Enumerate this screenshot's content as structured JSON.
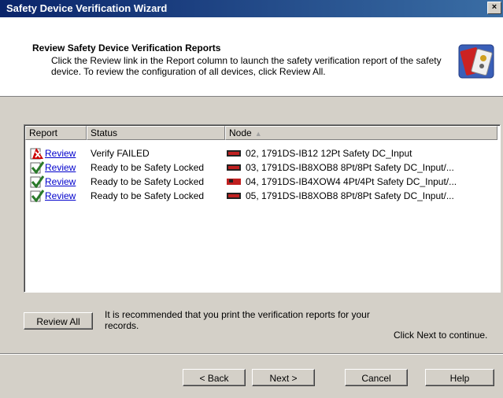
{
  "window": {
    "title": "Safety Device Verification Wizard",
    "close_label": "×"
  },
  "header": {
    "title": "Review Safety Device Verification Reports",
    "description": "Click the Review link in the Report column to launch the safety verification report of the safety device. To review the configuration of all devices, click Review All."
  },
  "table": {
    "columns": [
      "Report",
      "Status",
      "Node"
    ],
    "sort_indicator": "▲",
    "rows": [
      {
        "link": "Review",
        "status": "Verify FAILED",
        "node": "02, 1791DS-IB12 12Pt Safety DC_Input",
        "icon": "failed-x-icon"
      },
      {
        "link": "Review",
        "status": "Ready to be Safety Locked",
        "node": "03, 1791DS-IB8XOB8 8Pt/8Pt Safety DC_Input/...",
        "icon": "checkmark-icon"
      },
      {
        "link": "Review",
        "status": "Ready to be Safety Locked",
        "node": "04, 1791DS-IB4XOW4 4Pt/4Pt Safety DC_Input/...",
        "icon": "checkmark-icon"
      },
      {
        "link": "Review",
        "status": "Ready to be Safety Locked",
        "node": "05, 1791DS-IB8XOB8 8Pt/8Pt Safety DC_Input/...",
        "icon": "checkmark-icon"
      }
    ]
  },
  "review_all": {
    "button_label": "Review All",
    "note": "It is recommended that you print the verification reports for your records."
  },
  "continue_text": "Click Next to continue.",
  "footer": {
    "back": "< Back",
    "next": "Next >",
    "cancel": "Cancel",
    "help": "Help"
  }
}
